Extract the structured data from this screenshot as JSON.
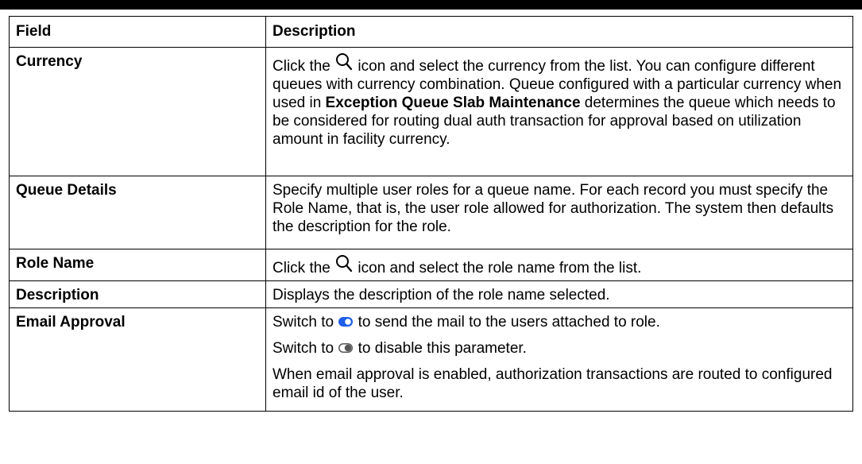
{
  "table": {
    "headers": {
      "field": "Field",
      "description": "Description"
    },
    "rows": {
      "currency": {
        "field": "Currency",
        "desc_before_icon": "Click the",
        "desc_after_icon": " icon and select the currency from the list. You can configure different queues with currency combination. Queue configured with a particular currency when used in ",
        "desc_bold": "Exception Queue Slab Maintenance",
        "desc_end": " determines the queue which needs to be considered for routing dual auth transaction for approval based on utilization amount in facility currency."
      },
      "queue_details": {
        "field": "Queue Details",
        "desc": "Specify multiple user roles for a queue name. For each record you must specify the Role Name, that is, the user role allowed for authorization. The system then defaults the description for the role."
      },
      "role_name": {
        "field": "Role Name",
        "desc_before_icon": "Click the",
        "desc_after_icon": " icon and select the role name from the list."
      },
      "description": {
        "field": "Description",
        "desc": "Displays the description of the role name selected."
      },
      "email_approval": {
        "field": "Email Approval",
        "on_before": "Switch to",
        "on_after": " to send the mail to the users attached to role.",
        "off_before": "Switch to",
        "off_after": " to disable this parameter.",
        "note": "When email approval is enabled, authorization transactions are routed to configured email id of the user."
      }
    }
  },
  "icons": {
    "search": "search-icon",
    "toggle_on": "toggle-on-icon",
    "toggle_off": "toggle-off-icon"
  },
  "colors": {
    "toggle_on": "#1f5ee8",
    "toggle_off_fill": "#ffffff",
    "toggle_off_border": "#555555"
  }
}
